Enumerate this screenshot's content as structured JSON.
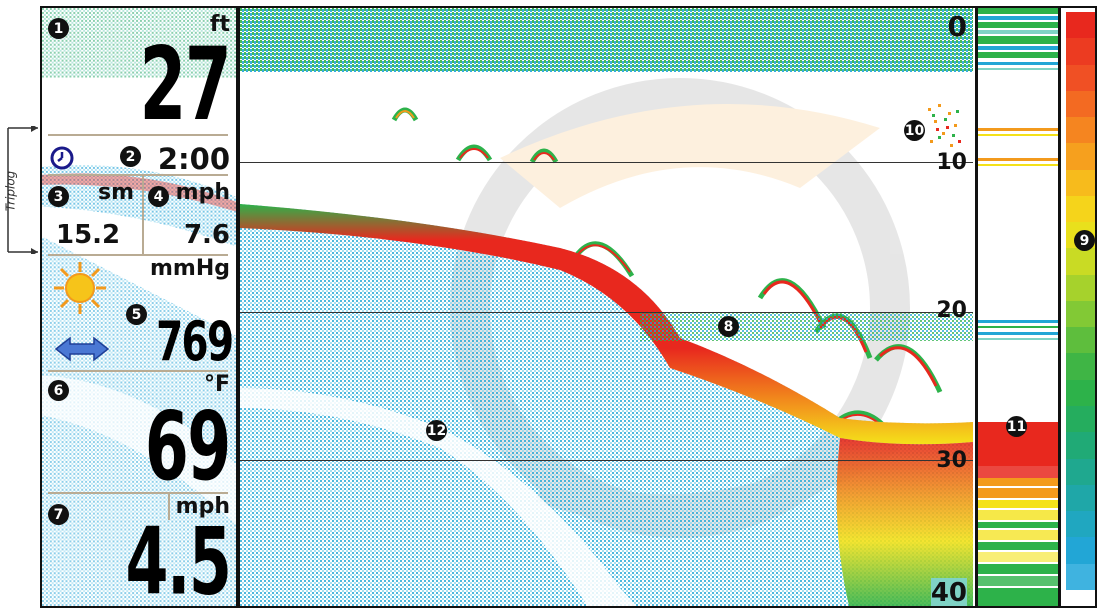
{
  "panel": {
    "depth": {
      "badge": "1",
      "unit": "ft",
      "value": "27"
    },
    "time": {
      "badge": "2",
      "value": "2:00"
    },
    "distance": {
      "badge": "3",
      "unit": "sm",
      "value": "15.2"
    },
    "speed": {
      "badge": "4",
      "unit": "mph",
      "value": "7.6"
    },
    "pressure": {
      "badge": "5",
      "unit": "mmHg",
      "value": "769",
      "weather_icon": "sun-icon",
      "trend_icon": "double-arrow-icon"
    },
    "temperature": {
      "badge": "6",
      "unit": "°F",
      "value": "69"
    },
    "wind": {
      "badge": "7",
      "unit": "mph",
      "value": "4.5"
    },
    "triplog_label": "Triplog"
  },
  "sonar": {
    "depth_scale": [
      "0",
      "10",
      "20",
      "30",
      "40"
    ],
    "callouts": {
      "thermocline": "8",
      "color_bar": "9",
      "surface_clutter": "10",
      "real_time_sonar": "11",
      "structure": "12"
    }
  },
  "colors": {
    "red": "#e8281e",
    "orange": "#f39a1c",
    "yellow": "#f4e21a",
    "green": "#2db24a",
    "cyan": "#22a6d6",
    "lightblue": "#7dd1ea"
  }
}
